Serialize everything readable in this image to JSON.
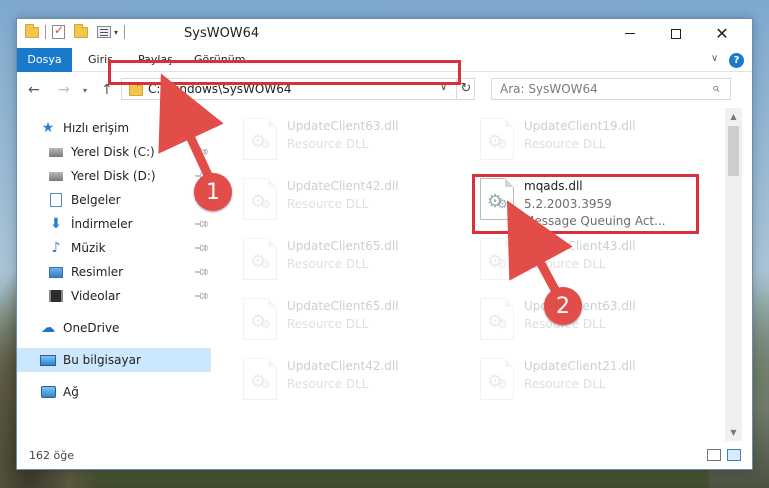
{
  "window": {
    "title": "SysWOW64",
    "controls": {
      "minimize": "—",
      "maximize": "",
      "close": "✕"
    }
  },
  "ribbon": {
    "tabs": [
      "Dosya",
      "Giriş",
      "Paylaş",
      "Görünüm"
    ],
    "help": "?"
  },
  "nav": {
    "back": "←",
    "forward": "→",
    "recent": "▾",
    "up": "↑",
    "address": "C:\\Windows\\SysWOW64",
    "address_dropdown": "∨",
    "refresh": "↻",
    "search_placeholder": "Ara: SysWOW64",
    "search_icon": "⌕"
  },
  "sidebar": {
    "items": [
      {
        "label": "Hızlı erişim",
        "icon": "star-icon",
        "pinned": false
      },
      {
        "label": "Yerel Disk (C:)",
        "icon": "drive-icon",
        "pinned": true
      },
      {
        "label": "Yerel Disk (D:)",
        "icon": "drive-icon",
        "pinned": true
      },
      {
        "label": "Belgeler",
        "icon": "documents-icon",
        "pinned": true
      },
      {
        "label": "İndirmeler",
        "icon": "download-icon",
        "pinned": true
      },
      {
        "label": "Müzik",
        "icon": "music-icon",
        "pinned": true
      },
      {
        "label": "Resimler",
        "icon": "pictures-icon",
        "pinned": true
      },
      {
        "label": "Videolar",
        "icon": "videos-icon",
        "pinned": true
      },
      {
        "label": "OneDrive",
        "icon": "onedrive-icon",
        "pinned": false
      },
      {
        "label": "Bu bilgisayar",
        "icon": "this-pc-icon",
        "pinned": false,
        "selected": true
      },
      {
        "label": "Ağ",
        "icon": "network-icon",
        "pinned": false
      }
    ]
  },
  "files": {
    "col1": [
      {
        "name": "UpdateClient63.dll",
        "type": "Resource DLL"
      },
      {
        "name": "UpdateClient42.dll",
        "type": "Resource DLL"
      },
      {
        "name": "UpdateClient65.dll",
        "type": "Resource DLL"
      },
      {
        "name": "UpdateClient65.dll",
        "type": "Resource DLL"
      },
      {
        "name": "UpdateClient42.dll",
        "type": "Resource DLL"
      }
    ],
    "col2": [
      {
        "name": "UpdateClient19.dll",
        "type": "Resource DLL"
      },
      {
        "name": "mqads.dll",
        "version": "5.2.2003.3959",
        "type": "Message Queuing Act..."
      },
      {
        "name": "UpdateClient43.dll",
        "type": "Resource DLL"
      },
      {
        "name": "UpdateClient63.dll",
        "type": "Resource DLL"
      },
      {
        "name": "UpdateClient21.dll",
        "type": "Resource DLL"
      }
    ]
  },
  "status": {
    "count": "162 öğe"
  },
  "annotations": {
    "step1": "1",
    "step2": "2",
    "accent": "#e24d4a"
  }
}
